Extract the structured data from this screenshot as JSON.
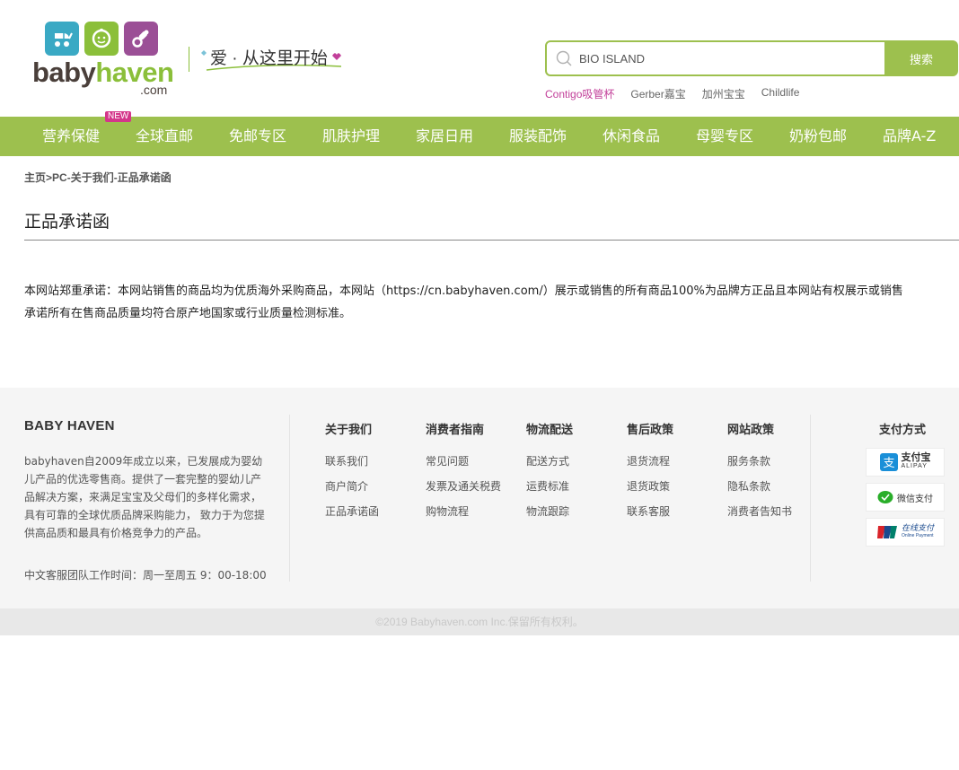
{
  "brand": {
    "logo_main": "baby",
    "logo_accent": "haven",
    "logo_suffix": ".com",
    "slogan": "爱 · 从这里开始"
  },
  "search": {
    "value": "BIO ISLAND",
    "button": "搜索",
    "hot": [
      "Contigo吸管杯",
      "Gerber嘉宝",
      "加州宝宝",
      "Childlife"
    ]
  },
  "nav": {
    "items": [
      "营养保健",
      "全球直邮",
      "免邮专区",
      "肌肤护理",
      "家居日用",
      "服装配饰",
      "休闲食品",
      "母婴专区",
      "奶粉包邮",
      "品牌A-Z"
    ],
    "badge": "NEW"
  },
  "breadcrumb": {
    "home": "主页",
    "sep": ">",
    "current": "PC-关于我们-正品承诺函"
  },
  "page": {
    "title": "正品承诺函",
    "line1": "本网站郑重承诺：本网站销售的商品均为优质海外采购商品，本网站（https://cn.babyhaven.com/）展示或销售的所有商品100%为品牌方正品且本网站有权展示或销售",
    "line2": "承诺所有在售商品质量均符合原产地国家或行业质量检测标准。"
  },
  "footer": {
    "brand": "BABY HAVEN",
    "about": "babyhaven自2009年成立以来，已发展成为婴幼儿产品的优选零售商。提供了一套完整的婴幼儿产品解决方案，来满足宝宝及父母们的多样化需求，具有可靠的全球优质品牌采购能力， 致力于为您提供高品质和最具有价格竞争力的产品。",
    "hours": "中文客服团队工作时间：周一至周五 9：00-18:00",
    "columns": [
      {
        "title": "关于我们",
        "links": [
          "联系我们",
          "商户简介",
          "正品承诺函"
        ]
      },
      {
        "title": "消费者指南",
        "links": [
          "常见问题",
          "发票及通关税费",
          "购物流程"
        ]
      },
      {
        "title": "物流配送",
        "links": [
          "配送方式",
          "运费标准",
          "物流跟踪"
        ]
      },
      {
        "title": "售后政策",
        "links": [
          "退货流程",
          "退货政策",
          "联系客服"
        ]
      },
      {
        "title": "网站政策",
        "links": [
          "服务条款",
          "隐私条款",
          "消费者告知书"
        ]
      }
    ],
    "payment": {
      "title": "支付方式",
      "alipay": "支付宝",
      "alipay_sub": "ALIPAY",
      "wechat": "微信支付",
      "unionpay": "在线支付",
      "unionpay_sub": "Online Payment"
    },
    "copyright": "©2019 Babyhaven.com Inc.保留所有权利。"
  },
  "colors": {
    "accent_green": "#9dc04e",
    "pink": "#c2409a",
    "teal_tile": "#3aa9c4",
    "green_tile": "#8bbf3a",
    "purple_tile": "#9b4f96"
  }
}
